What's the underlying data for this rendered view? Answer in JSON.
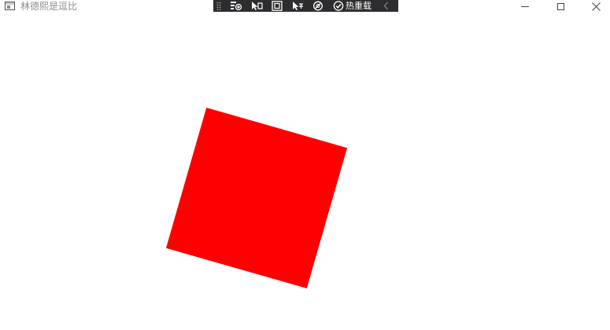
{
  "window": {
    "title": "林德熙是逗比"
  },
  "debug_toolbar": {
    "hot_reload_label": "热重载",
    "buttons": [
      "live-visual-tree-icon",
      "select-element-icon",
      "display-layout-adorners-icon",
      "track-focused-element-icon",
      "accessibility-checker-icon"
    ]
  },
  "content": {
    "shape": "square",
    "fill_color": "#ff0000",
    "rotation_deg": 16
  },
  "colors": {
    "toolbar_bg": "#2d2d30",
    "title_text": "#8c8c8c",
    "shape_fill": "#ff0000"
  }
}
